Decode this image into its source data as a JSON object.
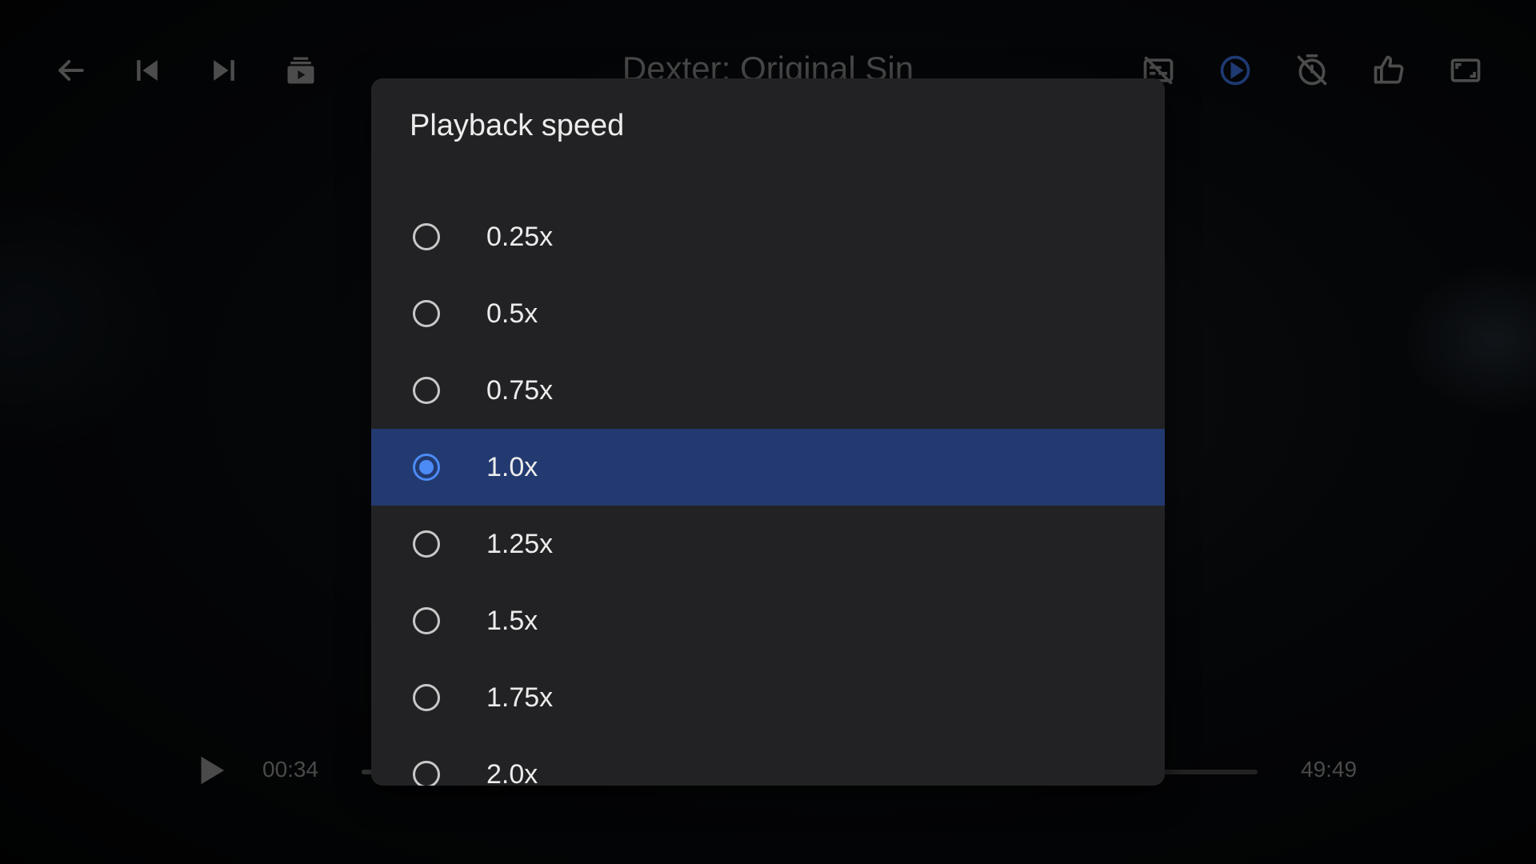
{
  "player": {
    "title": "Dexter: Original Sin",
    "current_time": "00:34",
    "total_time": "49:49",
    "progress_fraction": 0.0114,
    "top_icons_left": [
      "back-arrow-icon",
      "skip-previous-icon",
      "skip-next-icon",
      "playlist-icon"
    ],
    "top_icons_right": [
      "subtitles-off-icon",
      "playback-speed-icon",
      "sleep-timer-off-icon",
      "thumbs-up-icon",
      "aspect-ratio-icon"
    ],
    "play_icon": "play-icon"
  },
  "dialog": {
    "title": "Playback speed",
    "options": [
      {
        "label": "0.25x",
        "selected": false
      },
      {
        "label": "0.5x",
        "selected": false
      },
      {
        "label": "0.75x",
        "selected": false
      },
      {
        "label": "1.0x",
        "selected": true
      },
      {
        "label": "1.25x",
        "selected": false
      },
      {
        "label": "1.5x",
        "selected": false
      },
      {
        "label": "1.75x",
        "selected": false
      },
      {
        "label": "2.0x",
        "selected": false
      }
    ]
  },
  "colors": {
    "accent": "#4c8bf5",
    "selected_row": "#223a70",
    "dialog_bg": "#222224"
  }
}
